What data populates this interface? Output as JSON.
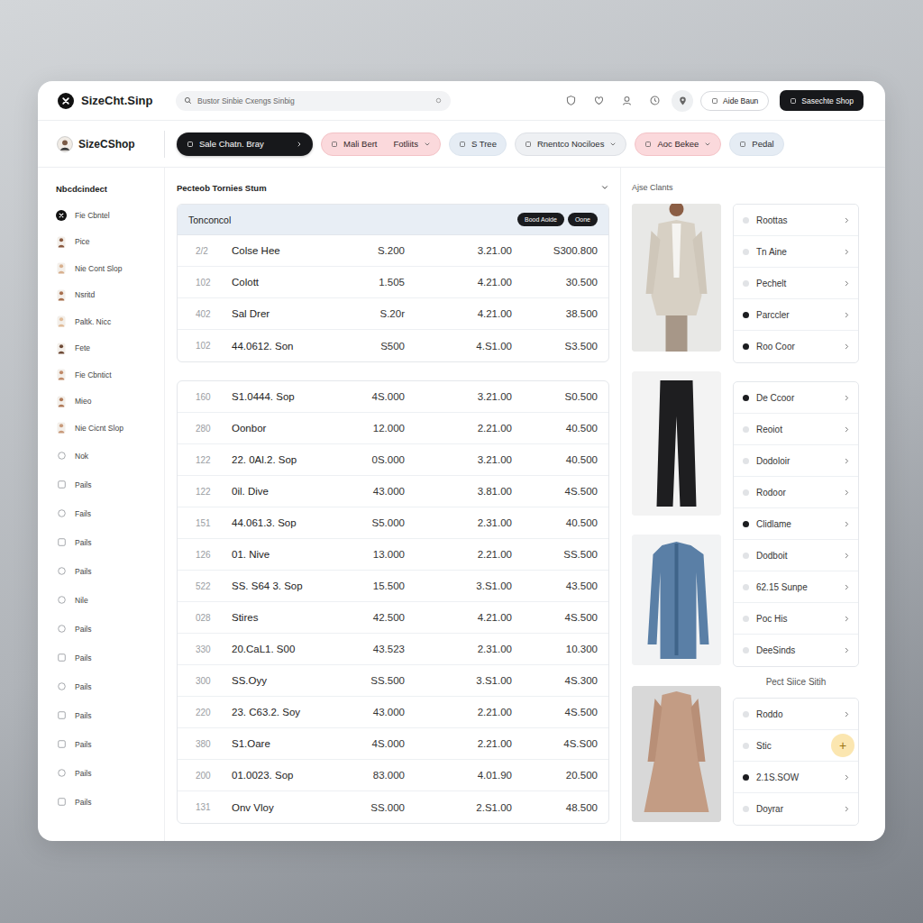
{
  "topbar": {
    "brand": "SizeCht.Sinp",
    "search": {
      "placeholder": "Bustor Sinbie Cxengs Sinbig"
    },
    "secondary_button": "Aide Baun",
    "primary_button": "Sasechte Shop"
  },
  "toolbar": {
    "brand": "SizeCShop",
    "pills": [
      {
        "label": "Sale Chatn. Bray",
        "kind": "dark",
        "menu": true,
        "selected": true
      },
      {
        "label": "Mali Bert",
        "suffix": "Fotliits",
        "kind": "pink",
        "menu": true,
        "selected": false
      },
      {
        "label": "S Tree",
        "kind": "blue",
        "menu": false,
        "selected": false
      },
      {
        "label": "Rnentco Nociloes",
        "kind": "gray",
        "menu": true,
        "selected": false
      },
      {
        "label": "Aoc Bekee",
        "kind": "pink",
        "menu": true,
        "selected": false
      },
      {
        "label": "Pedal",
        "kind": "blue",
        "menu": false,
        "selected": false
      }
    ]
  },
  "sidebar": {
    "title": "Nbcdcindect",
    "items": [
      {
        "label": "Fie Cbntel",
        "kind": "brand"
      },
      {
        "label": "Pice",
        "kind": "avatar"
      },
      {
        "label": "Nie Cont Slop",
        "kind": "avatar"
      },
      {
        "label": "Nsritd",
        "kind": "avatar"
      },
      {
        "label": "Paltk. Nicc",
        "kind": "avatar"
      },
      {
        "label": "Fete",
        "kind": "avatar"
      },
      {
        "label": "Fie Cbntict",
        "kind": "avatar"
      },
      {
        "label": "Mieo",
        "kind": "avatar"
      },
      {
        "label": "Nie Cicnt Slop",
        "kind": "avatar"
      },
      {
        "label": "Nok",
        "kind": "round"
      },
      {
        "label": "Pails",
        "kind": "square"
      },
      {
        "label": "Fails",
        "kind": "round"
      },
      {
        "label": "Pails",
        "kind": "square"
      },
      {
        "label": "Pails",
        "kind": "round"
      },
      {
        "label": "Nile",
        "kind": "round"
      },
      {
        "label": "Pails",
        "kind": "round"
      },
      {
        "label": "Pails",
        "kind": "square"
      },
      {
        "label": "Pails",
        "kind": "round"
      },
      {
        "label": "Pails",
        "kind": "square"
      },
      {
        "label": "Pails",
        "kind": "square"
      },
      {
        "label": "Pails",
        "kind": "round"
      },
      {
        "label": "Pails",
        "kind": "square"
      }
    ]
  },
  "content": {
    "title": "Pecteob Tornies Stum",
    "tables": [
      {
        "title": "Tonconcol",
        "buttons": [
          "Bood Aoide",
          "Oone"
        ],
        "rows": [
          [
            "2/2",
            "Colse Hee",
            "S.200",
            "3.21.00",
            "S300.800"
          ],
          [
            "102",
            "Colott",
            "1.505",
            "4.21.00",
            "30.500"
          ],
          [
            "402",
            "Sal Drer",
            "S.20r",
            "4.21.00",
            "38.500"
          ],
          [
            "102",
            "44.0612. Son",
            "S500",
            "4.S1.00",
            "S3.500"
          ]
        ]
      },
      {
        "rows": [
          [
            "160",
            "S1.0444. Sop",
            "4S.000",
            "3.21.00",
            "S0.500"
          ],
          [
            "280",
            "Oonbor",
            "12.000",
            "2.21.00",
            "40.500"
          ],
          [
            "122",
            "22. 0Al.2. Sop",
            "0S.000",
            "3.21.00",
            "40.500"
          ],
          [
            "122",
            "0il. Dive",
            "43.000",
            "3.81.00",
            "4S.500"
          ],
          [
            "151",
            "44.061.3. Sop",
            "S5.000",
            "2.31.00",
            "40.500"
          ],
          [
            "126",
            "01. Nive",
            "13.000",
            "2.21.00",
            "SS.500"
          ],
          [
            "522",
            "SS. S64 3. Sop",
            "15.500",
            "3.S1.00",
            "43.500"
          ],
          [
            "028",
            "Stires",
            "42.500",
            "4.21.00",
            "4S.500"
          ],
          [
            "330",
            "20.CaL1. S00",
            "43.523",
            "2.31.00",
            "10.300"
          ],
          [
            "300",
            "SS.Oyy",
            "SS.500",
            "3.S1.00",
            "4S.300"
          ],
          [
            "220",
            "23. C63.2. Soy",
            "43.000",
            "2.21.00",
            "4S.500"
          ],
          [
            "380",
            "S1.Oare",
            "4S.000",
            "2.21.00",
            "4S.S00"
          ],
          [
            "200",
            "01.0023. Sop",
            "83.000",
            "4.01.90",
            "20.500"
          ],
          [
            "131",
            "Onv Vloy",
            "SS.000",
            "2.S1.00",
            "48.500"
          ]
        ]
      }
    ]
  },
  "gallery": {
    "title": "Ajse Clants",
    "groups": [
      {
        "items": [
          {
            "label": "Roottas",
            "marked": false
          },
          {
            "label": "Tn Aine",
            "marked": false
          },
          {
            "label": "Pechelt",
            "marked": false
          },
          {
            "label": "Parccler",
            "marked": true
          },
          {
            "label": "Roo Coor",
            "marked": true
          }
        ]
      },
      {
        "items": [
          {
            "label": "De Ccoor",
            "marked": true
          },
          {
            "label": "Reoiot",
            "marked": false
          },
          {
            "label": "Dodoloir",
            "marked": false
          },
          {
            "label": "Rodoor",
            "marked": false
          },
          {
            "label": "Clidlame",
            "marked": true
          },
          {
            "label": "Dodboit",
            "marked": false
          },
          {
            "label": "62.15 Sunpe",
            "marked": false
          },
          {
            "label": "Poc His",
            "marked": false
          },
          {
            "label": "DeeSinds",
            "marked": false
          }
        ]
      },
      {
        "caption": "Pect Siice Sitih",
        "items": [
          {
            "label": "Roddo",
            "marked": false
          },
          {
            "label": "Stic",
            "marked": false,
            "badge": "+"
          },
          {
            "label": "2.1S.SOW",
            "marked": true
          },
          {
            "label": "Doyrar",
            "marked": false
          }
        ]
      }
    ]
  }
}
